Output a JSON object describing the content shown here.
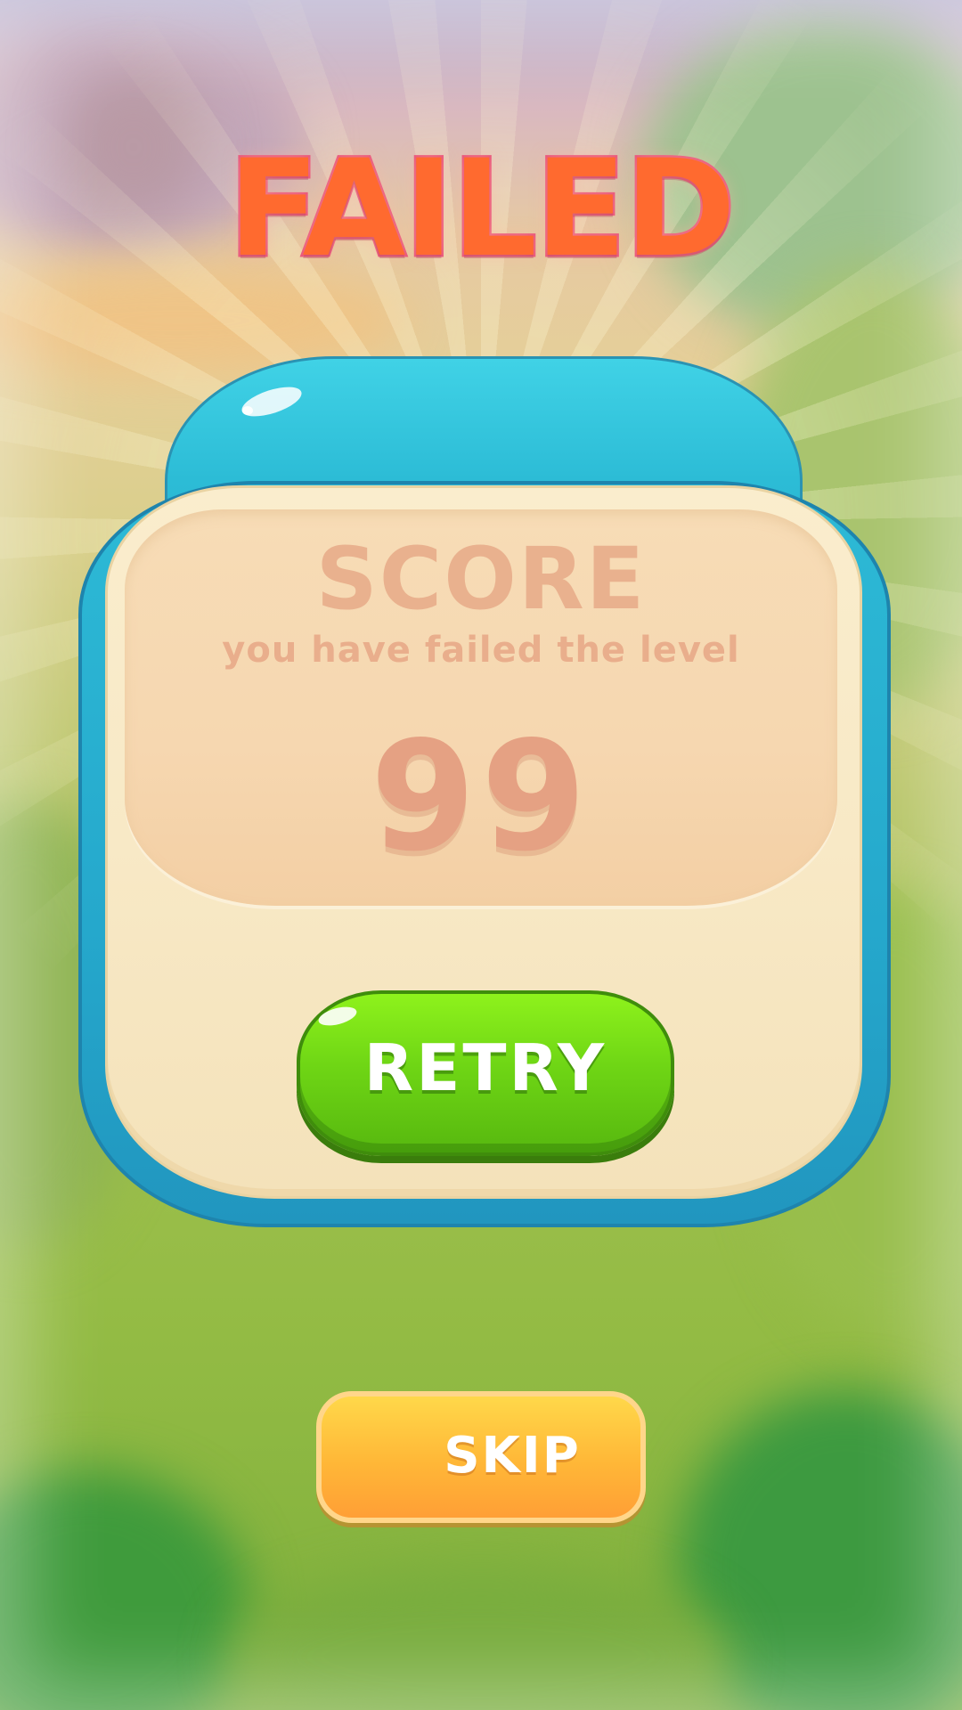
{
  "screen": {
    "title": "FAILED"
  },
  "result_panel": {
    "score_label": "SCORE",
    "message": "you have failed the level",
    "score_value": "99"
  },
  "buttons": {
    "retry_label": "RETRY",
    "skip_label": "SKIP"
  },
  "colors": {
    "title": "#ff6a2f",
    "panel_frame": "#2cbcd6",
    "panel_body": "#f8e9c6",
    "score_text": "#e9b18e",
    "retry_button": "#6fd615",
    "skip_button": "#ffb737"
  }
}
